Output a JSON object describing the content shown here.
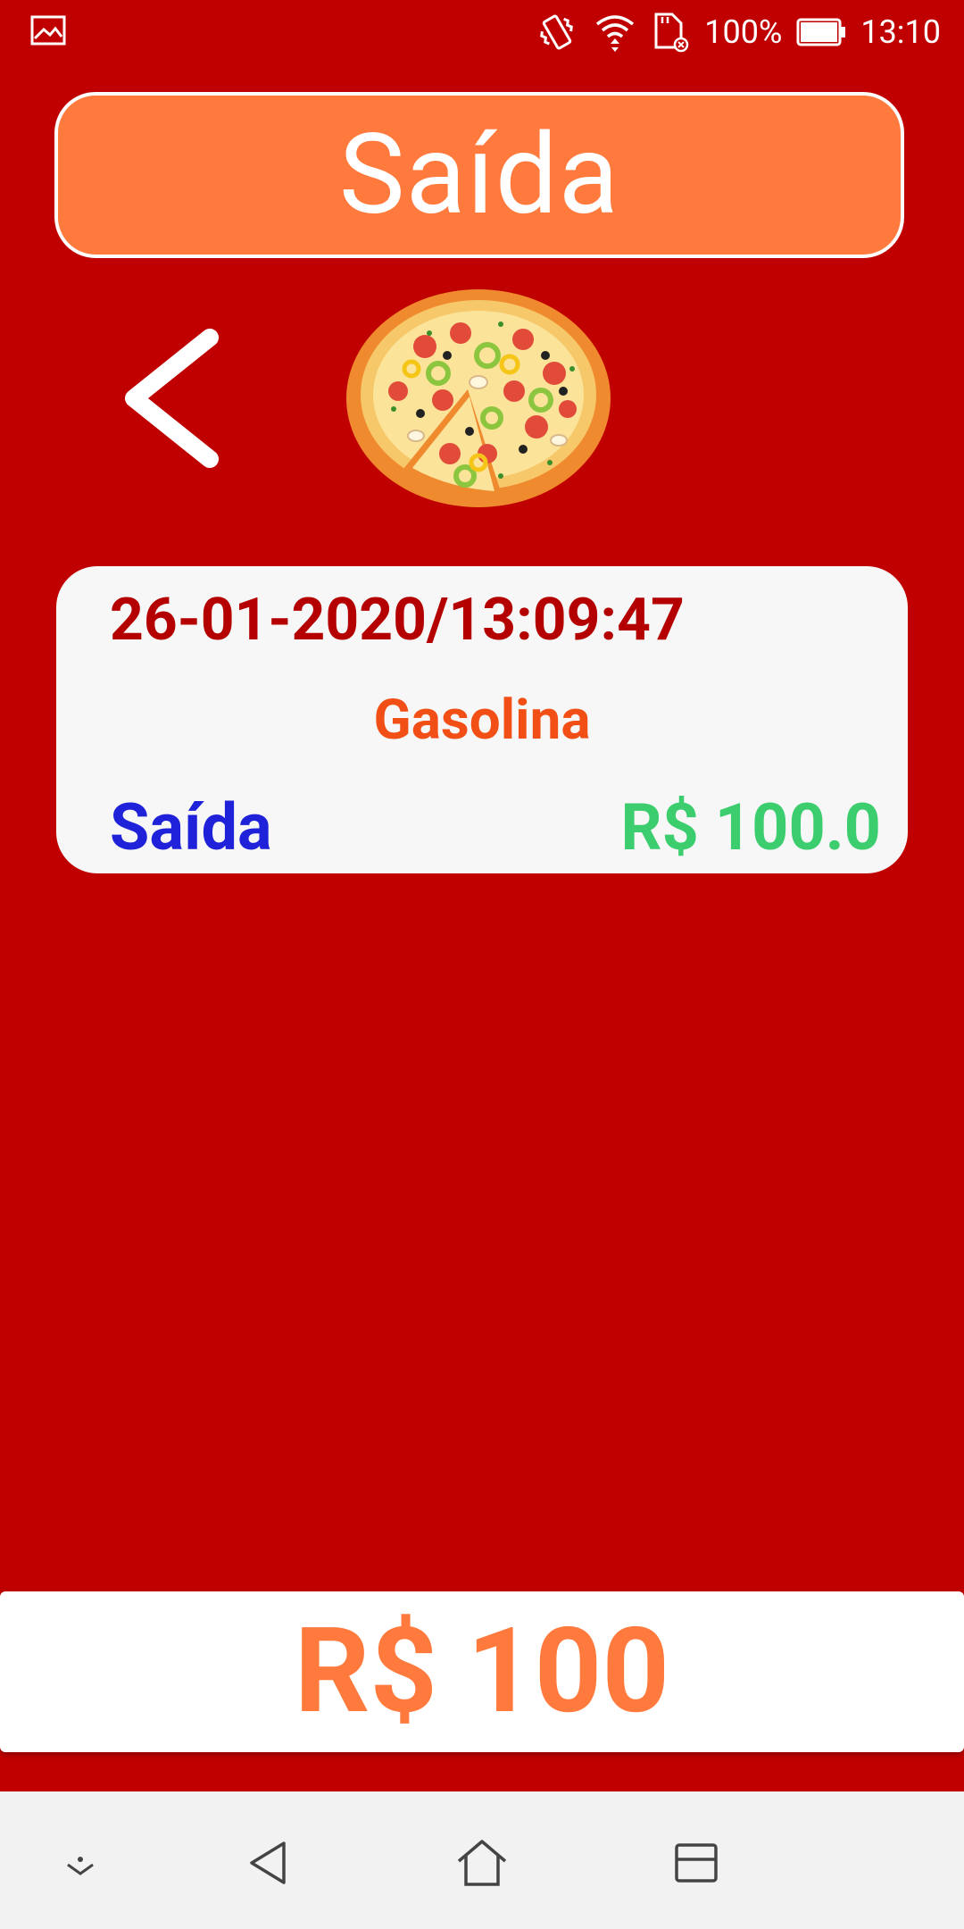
{
  "status_bar": {
    "battery_text": "100%",
    "time": "13:10",
    "icons": [
      "gallery-icon",
      "vibrate-icon",
      "wifi-icon",
      "sd-card-icon",
      "battery-icon"
    ]
  },
  "header": {
    "title": "Saída"
  },
  "entry": {
    "datetime": "26-01-2020/13:09:47",
    "category": "Gasolina",
    "type": "Saída",
    "amount": "R$ 100.0"
  },
  "total": {
    "amount": "R$ 100"
  },
  "colors": {
    "background": "#c00000",
    "accent_orange": "#ff7a3c",
    "datetime_red": "#b40000",
    "category_orange": "#f24f16",
    "type_blue": "#1f22d9",
    "amount_green": "#3ccd6e"
  },
  "nav_bar": {
    "icons": [
      "nav-down-icon",
      "nav-back-icon",
      "nav-home-icon",
      "nav-recents-icon"
    ]
  }
}
